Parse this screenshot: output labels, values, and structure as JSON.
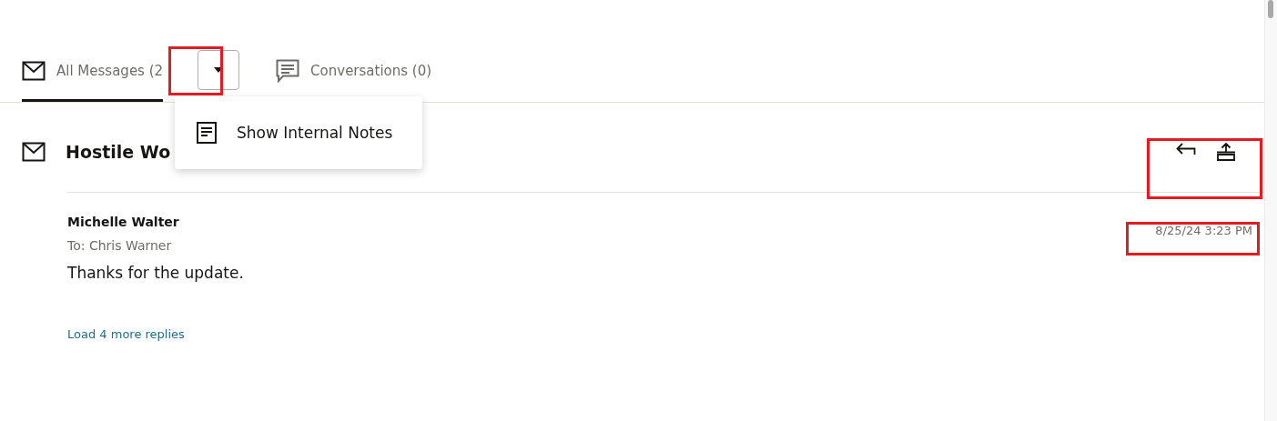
{
  "tabs": [
    {
      "label": "All Messages (2",
      "selected": true
    },
    {
      "label": "Conversations (0)",
      "selected": false
    }
  ],
  "menu": {
    "items": [
      {
        "label": "Show Internal Notes"
      }
    ]
  },
  "thread": {
    "title": "Hostile Wo",
    "message": {
      "sender": "Michelle Walter",
      "to": "To: Chris Warner",
      "timestamp": "8/25/24 3:23 PM",
      "body": "Thanks for the update."
    },
    "load_more": "Load 4 more replies"
  }
}
